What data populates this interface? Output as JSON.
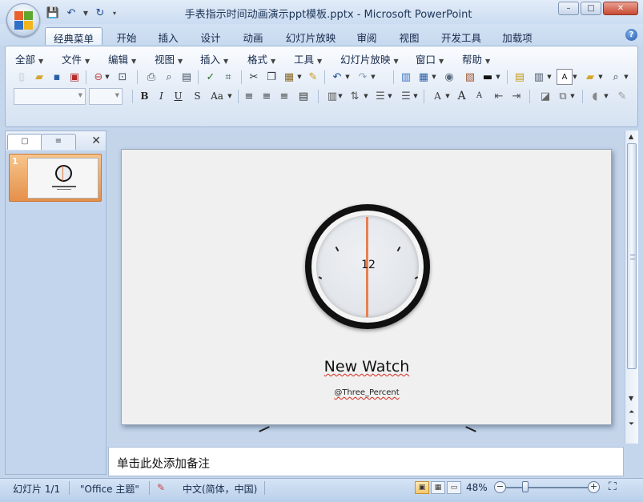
{
  "window": {
    "title": "手表指示时间动画演示ppt模板.pptx - Microsoft PowerPoint",
    "minimize": "–",
    "maximize": "□",
    "close": "✕"
  },
  "qat": {
    "save_icon": "save-icon",
    "undo_icon": "undo-icon",
    "redo_icon": "redo-icon"
  },
  "tabs": [
    {
      "label": "经典菜单",
      "active": true
    },
    {
      "label": "开始"
    },
    {
      "label": "插入"
    },
    {
      "label": "设计"
    },
    {
      "label": "动画"
    },
    {
      "label": "幻灯片放映"
    },
    {
      "label": "审阅"
    },
    {
      "label": "视图"
    },
    {
      "label": "开发工具"
    },
    {
      "label": "加载项"
    }
  ],
  "help_label": "?",
  "menus": [
    {
      "label": "全部"
    },
    {
      "label": "文件"
    },
    {
      "label": "编辑"
    },
    {
      "label": "视图"
    },
    {
      "label": "插入"
    },
    {
      "label": "格式"
    },
    {
      "label": "工具"
    },
    {
      "label": "幻灯片放映"
    },
    {
      "label": "窗口"
    },
    {
      "label": "帮助"
    }
  ],
  "format_buttons": {
    "bold": "B",
    "italic": "I",
    "underline": "U",
    "shadow": "S",
    "change_case": "Aa",
    "font_color": "A",
    "grow_font": "A",
    "shrink_font": "A"
  },
  "left_panel": {
    "tab_slides_glyph": "▢",
    "tab_outline_glyph": "≡",
    "close": "✕",
    "slide_number": "1"
  },
  "slide": {
    "twelve": "12",
    "title": "New Watch",
    "subtitle": "@Three_Percent"
  },
  "notes": {
    "placeholder": "单击此处添加备注"
  },
  "status": {
    "slide_info": "幻灯片 1/1",
    "theme": "\"Office 主题\"",
    "language": "中文(简体，中国)",
    "zoom": "48%",
    "zoom_out": "−",
    "zoom_in": "+"
  },
  "colors": {
    "hand": "#e8804f",
    "accent_tab": "#e5904a",
    "ribbon": "#d5e2f2"
  }
}
